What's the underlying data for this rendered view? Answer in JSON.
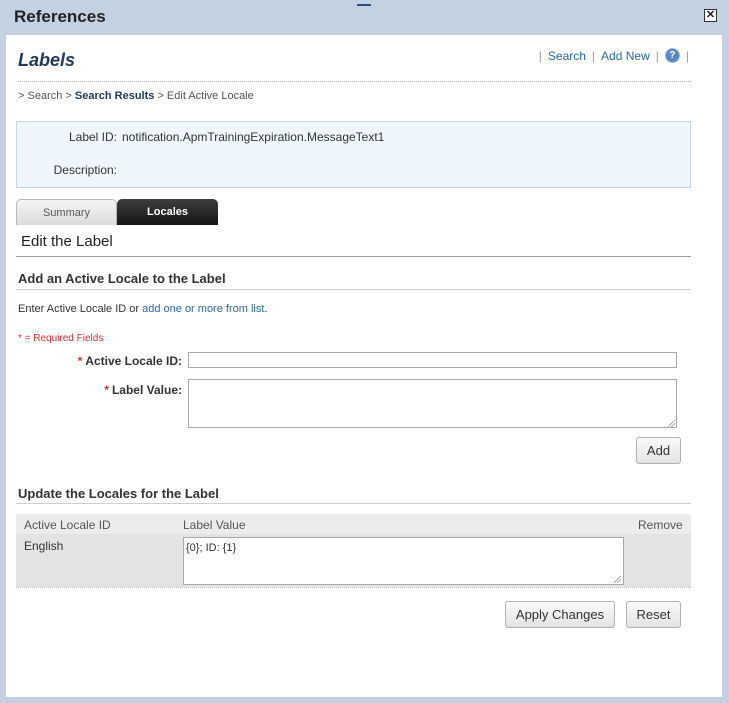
{
  "window": {
    "title": "References",
    "close_symbol": "✕",
    "grip_icon": "drag-handle-icon"
  },
  "header": {
    "heading": "Labels",
    "links": [
      "Search",
      "Add New"
    ],
    "separator": "|",
    "help_symbol": "?"
  },
  "breadcrumb": {
    "prefix_1": "> Search >",
    "current_link": "Search Results",
    "suffix": "> Edit Active Locale"
  },
  "info": {
    "label_id_label": "Label ID:",
    "label_id_value": "notification.ApmTrainingExpiration.MessageText1",
    "description_label": "Description:",
    "description_value": ""
  },
  "tabs": [
    {
      "label": "Summary",
      "active": false
    },
    {
      "label": "Locales",
      "active": true
    }
  ],
  "edit": {
    "title": "Edit the Label"
  },
  "add_section": {
    "title": "Add an Active Locale to the Label",
    "intro_text": "Enter Active Locale ID or ",
    "intro_link": "add one or more from list",
    "intro_end": ".",
    "required_note": "* = Required Fields",
    "active_locale_label": "Active Locale ID:",
    "active_locale_value": "",
    "label_value_label": "Label Value:",
    "label_value_value": "",
    "required_star": "*",
    "add_button": "Add"
  },
  "update_section": {
    "title": "Update the Locales for the Label",
    "columns": [
      "Active Locale ID",
      "Label Value",
      "Remove"
    ],
    "rows": [
      {
        "locale": "English",
        "value": "{0}; ID: {1}"
      }
    ]
  },
  "actions": {
    "apply": "Apply Changes",
    "reset": "Reset"
  },
  "colors": {
    "frame": "#c3d1e3",
    "heading": "#1f3a5c",
    "link": "#2a6ab5",
    "required": "#e0312e",
    "info_bg": "#eef6fb"
  }
}
